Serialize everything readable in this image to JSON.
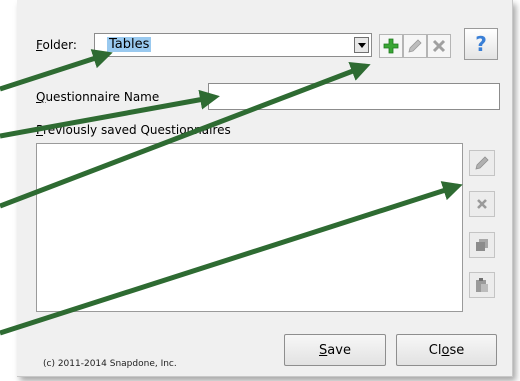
{
  "form": {
    "folder_label": "Folder:",
    "folder_value": "Tables",
    "questionnaire_name_label": "Questionnaire Name",
    "questionnaire_name_value": "",
    "saved_list_label": "Previously saved Questionnaires",
    "saved_items": []
  },
  "toolbar": {
    "add_icon": "plus-icon",
    "edit_icon": "pencil-icon",
    "delete_icon": "x-icon",
    "help_label": "?"
  },
  "side_buttons": [
    "pencil-icon",
    "x-icon",
    "copy-icon",
    "paste-icon"
  ],
  "buttons": {
    "save_label": "Save",
    "close_label": "Close"
  },
  "footer": {
    "copyright": "(c) 2011-2014 Snapdone, Inc."
  },
  "colors": {
    "arrow": "#2e6b32",
    "selection": "#99c9ef",
    "add_green": "#3aa635",
    "help_blue": "#3a7fd6"
  }
}
